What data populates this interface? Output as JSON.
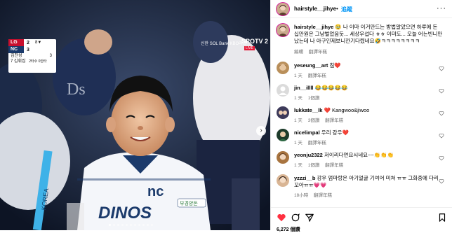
{
  "media": {
    "scoreboard": {
      "team1": "LG",
      "score1": "2",
      "team2": "NC",
      "score2": "3",
      "inning": "8▼",
      "line1": "김찬성",
      "line1b": "3",
      "line2": "7 김휘집",
      "line2b": "2타수 0안타"
    },
    "broadcast": "신한 SOL Bank KBO리그",
    "channel": "SPOTV 2",
    "channel_sub": "LIVE",
    "jersey_text": "nc",
    "jersey_name": "DINOS",
    "patch": "부경양돈"
  },
  "header": {
    "username": "hairstyle__jihye",
    "dot": "•",
    "follow": "追蹤",
    "more": "···"
  },
  "comments": [
    {
      "user": "hairstyle__jihye",
      "text": "🥹 나 이마 이거만드는 방법알았으면 하루에 돈 십만원은 그냥벌었음듯... 세상우섭다 ㅎㅎ 이미도... 오늘 어는빈니만났는데 나 아구인제보니깐기다렸네요🤣ㅋㅋㅋㅋㅋㅋㅋㅋ",
      "time": "編輯",
      "trans": "翻譯年糕"
    },
    {
      "user": "yeseung__art",
      "text": "침❤️",
      "time": "1 天",
      "trans": "翻譯年糕"
    },
    {
      "user": "jin__illll",
      "text": "😂😂😂😂😂",
      "time": "1 天",
      "trans": "1個讚"
    },
    {
      "user": "lukkate__lk",
      "text": "❤️ Kangwoo&jiwoo",
      "time": "1 天",
      "trans": "3個讚",
      "trans2": "翻譯年糕"
    },
    {
      "user": "nicelimpal",
      "text": "우리 강우❤️",
      "time": "1 天",
      "trans": "翻譯年糕"
    },
    {
      "user": "yeonju2322",
      "text": "저이리다면요시네요~~👏👏👏",
      "time": "1 天",
      "trans": "1個讚",
      "trans2": "翻譯年糕"
    },
    {
      "user": "yzzzi__b",
      "text": "강우 엄마랑은 아기얼굴 기여어 미쳐 ㅠㅠ 그화중에 다리꼬아ㅠㅠ💗💗",
      "time": "18小時",
      "trans": "翻譯年糕"
    }
  ],
  "footer": {
    "likes": "6,272 個讚"
  }
}
